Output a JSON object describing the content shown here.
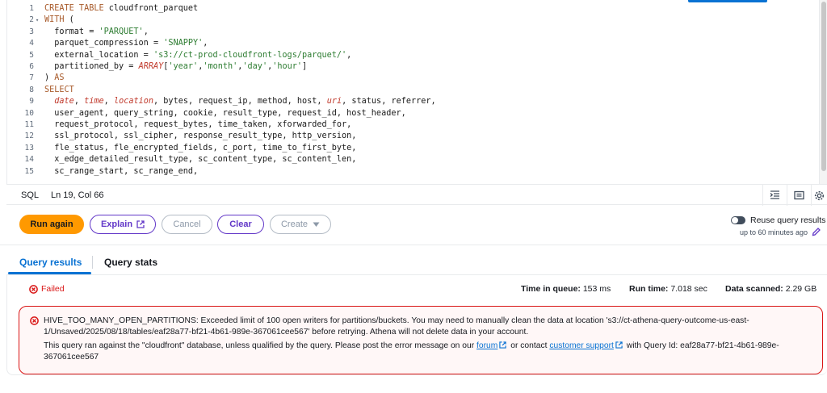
{
  "editor": {
    "lines": [
      {
        "n": "1",
        "fold": "",
        "tokens": [
          {
            "c": "kw",
            "t": "CREATE TABLE "
          },
          {
            "c": "id",
            "t": "cloudfront_parquet"
          }
        ]
      },
      {
        "n": "2",
        "fold": "▾",
        "tokens": [
          {
            "c": "kw",
            "t": "WITH "
          },
          {
            "c": "pun",
            "t": "("
          }
        ]
      },
      {
        "n": "3",
        "fold": "",
        "tokens": [
          {
            "c": "id",
            "t": "  format "
          },
          {
            "c": "pun",
            "t": "= "
          },
          {
            "c": "str",
            "t": "'PARQUET'"
          },
          {
            "c": "pun",
            "t": ","
          }
        ]
      },
      {
        "n": "4",
        "fold": "",
        "tokens": [
          {
            "c": "id",
            "t": "  parquet_compression "
          },
          {
            "c": "pun",
            "t": "= "
          },
          {
            "c": "str",
            "t": "'SNAPPY'"
          },
          {
            "c": "pun",
            "t": ","
          }
        ]
      },
      {
        "n": "5",
        "fold": "",
        "tokens": [
          {
            "c": "id",
            "t": "  external_location "
          },
          {
            "c": "pun",
            "t": "= "
          },
          {
            "c": "str",
            "t": "'s3://ct-prod-cloudfront-logs/parquet/'"
          },
          {
            "c": "pun",
            "t": ","
          }
        ]
      },
      {
        "n": "6",
        "fold": "",
        "tokens": [
          {
            "c": "id",
            "t": "  partitioned_by "
          },
          {
            "c": "pun",
            "t": "= "
          },
          {
            "c": "fn",
            "t": "ARRAY"
          },
          {
            "c": "pun",
            "t": "["
          },
          {
            "c": "str",
            "t": "'year'"
          },
          {
            "c": "pun",
            "t": ","
          },
          {
            "c": "str",
            "t": "'month'"
          },
          {
            "c": "pun",
            "t": ","
          },
          {
            "c": "str",
            "t": "'day'"
          },
          {
            "c": "pun",
            "t": ","
          },
          {
            "c": "str",
            "t": "'hour'"
          },
          {
            "c": "pun",
            "t": "]"
          }
        ]
      },
      {
        "n": "7",
        "fold": "",
        "tokens": [
          {
            "c": "pun",
            "t": ") "
          },
          {
            "c": "kw",
            "t": "AS"
          }
        ]
      },
      {
        "n": "8",
        "fold": "",
        "tokens": [
          {
            "c": "kw",
            "t": "SELECT"
          }
        ]
      },
      {
        "n": "9",
        "fold": "",
        "tokens": [
          {
            "c": "id",
            "t": "  "
          },
          {
            "c": "fn",
            "t": "date"
          },
          {
            "c": "pun",
            "t": ", "
          },
          {
            "c": "fn",
            "t": "time"
          },
          {
            "c": "pun",
            "t": ", "
          },
          {
            "c": "fn",
            "t": "location"
          },
          {
            "c": "pun",
            "t": ", "
          },
          {
            "c": "id",
            "t": "bytes, request_ip, method, host, "
          },
          {
            "c": "fn",
            "t": "uri"
          },
          {
            "c": "pun",
            "t": ", "
          },
          {
            "c": "id",
            "t": "status, referrer,"
          }
        ]
      },
      {
        "n": "10",
        "fold": "",
        "tokens": [
          {
            "c": "id",
            "t": "  user_agent, query_string, cookie, result_type, request_id, host_header,"
          }
        ]
      },
      {
        "n": "11",
        "fold": "",
        "tokens": [
          {
            "c": "id",
            "t": "  request_protocol, request_bytes, time_taken, xforwarded_for,"
          }
        ]
      },
      {
        "n": "12",
        "fold": "",
        "tokens": [
          {
            "c": "id",
            "t": "  ssl_protocol, ssl_cipher, response_result_type, http_version,"
          }
        ]
      },
      {
        "n": "13",
        "fold": "",
        "tokens": [
          {
            "c": "id",
            "t": "  fle_status, fle_encrypted_fields, c_port, time_to_first_byte,"
          }
        ]
      },
      {
        "n": "14",
        "fold": "",
        "tokens": [
          {
            "c": "id",
            "t": "  x_edge_detailed_result_type, sc_content_type, sc_content_len,"
          }
        ]
      },
      {
        "n": "15",
        "fold": "",
        "tokens": [
          {
            "c": "id",
            "t": "  sc_range_start, sc_range_end,"
          }
        ]
      }
    ]
  },
  "statusbar": {
    "language": "SQL",
    "cursor": "Ln 19, Col 66"
  },
  "actions": {
    "run_again": "Run again",
    "explain": "Explain",
    "cancel": "Cancel",
    "clear": "Clear",
    "create": "Create"
  },
  "reuse": {
    "label": "Reuse query results",
    "sub": "up to 60 minutes ago"
  },
  "tabs": {
    "results": "Query results",
    "stats": "Query stats"
  },
  "result": {
    "status": "Failed",
    "time_in_queue_label": "Time in queue:",
    "time_in_queue": "153 ms",
    "run_time_label": "Run time:",
    "run_time": "7.018 sec",
    "data_scanned_label": "Data scanned:",
    "data_scanned": "2.29 GB"
  },
  "error": {
    "message": "HIVE_TOO_MANY_OPEN_PARTITIONS: Exceeded limit of 100 open writers for partitions/buckets. You may need to manually clean the data at location 's3://ct-athena-query-outcome-us-east-1/Unsaved/2025/08/18/tables/eaf28a77-bf21-4b61-989e-367061cee567' before retrying. Athena will not delete data in your account.",
    "detail_prefix": "This query ran against the \"cloudfront\" database, unless qualified by the query. Please post the error message on our",
    "forum_link": "forum",
    "detail_middle": "or contact",
    "support_link": "customer support",
    "detail_suffix": "with Query Id: eaf28a77-bf21-4b61-989e-367061cee567"
  },
  "colors": {
    "primary": "#ff9900",
    "link": "#0972d3",
    "accent": "#6237c8",
    "error": "#d91515"
  }
}
